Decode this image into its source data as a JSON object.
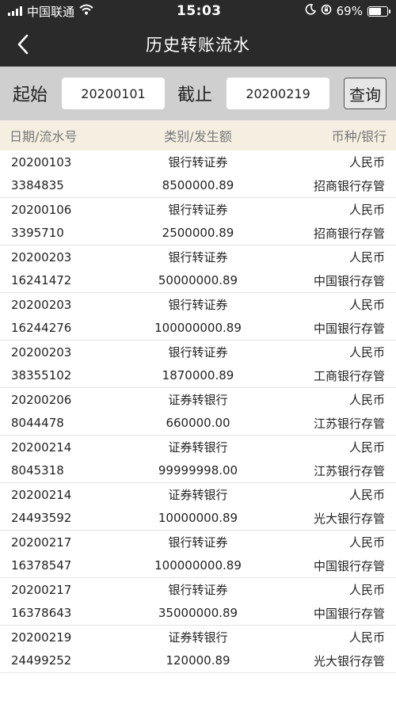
{
  "status_bar": {
    "carrier": "中国联通",
    "time": "15:03",
    "battery": "69%",
    "battery_level": 0.69,
    "icons": [
      "signal-icon",
      "wifi-icon",
      "moon-icon",
      "orientation-lock-icon",
      "battery-icon"
    ]
  },
  "nav": {
    "title": "历史转账流水",
    "back_icon": "chevron-left-icon"
  },
  "filter": {
    "start_label": "起始",
    "start_value": "20200101",
    "end_label": "截止",
    "end_value": "20200219",
    "query_label": "查询"
  },
  "table": {
    "headers": [
      "日期/流水号",
      "类别/发生额",
      "币种/银行"
    ],
    "records": [
      {
        "date": "20200103",
        "serial": "3384835",
        "type": "银行转证券",
        "amount": "8500000.89",
        "currency": "人民币",
        "bank": "招商银行存管"
      },
      {
        "date": "20200106",
        "serial": "3395710",
        "type": "银行转证券",
        "amount": "2500000.89",
        "currency": "人民币",
        "bank": "招商银行存管"
      },
      {
        "date": "20200203",
        "serial": "16241472",
        "type": "银行转证券",
        "amount": "50000000.89",
        "currency": "人民币",
        "bank": "中国银行存管"
      },
      {
        "date": "20200203",
        "serial": "16244276",
        "type": "银行转证券",
        "amount": "100000000.89",
        "currency": "人民币",
        "bank": "中国银行存管"
      },
      {
        "date": "20200203",
        "serial": "38355102",
        "type": "银行转证券",
        "amount": "1870000.89",
        "currency": "人民币",
        "bank": "工商银行存管"
      },
      {
        "date": "20200206",
        "serial": "8044478",
        "type": "证券转银行",
        "amount": "660000.00",
        "currency": "人民币",
        "bank": "江苏银行存管"
      },
      {
        "date": "20200214",
        "serial": "8045318",
        "type": "证券转银行",
        "amount": "99999998.00",
        "currency": "人民币",
        "bank": "江苏银行存管"
      },
      {
        "date": "20200214",
        "serial": "24493592",
        "type": "证券转银行",
        "amount": "10000000.89",
        "currency": "人民币",
        "bank": "光大银行存管"
      },
      {
        "date": "20200217",
        "serial": "16378547",
        "type": "银行转证券",
        "amount": "100000000.89",
        "currency": "人民币",
        "bank": "中国银行存管"
      },
      {
        "date": "20200217",
        "serial": "16378643",
        "type": "银行转证券",
        "amount": "35000000.89",
        "currency": "人民币",
        "bank": "中国银行存管"
      },
      {
        "date": "20200219",
        "serial": "24499252",
        "type": "证券转银行",
        "amount": "120000.89",
        "currency": "人民币",
        "bank": "光大银行存管"
      }
    ]
  },
  "colors": {
    "bar_bg": "#2a2a2a",
    "filter_bg": "#cfcfcf",
    "header_bg": "#f5efe1",
    "header_text": "#777777"
  }
}
